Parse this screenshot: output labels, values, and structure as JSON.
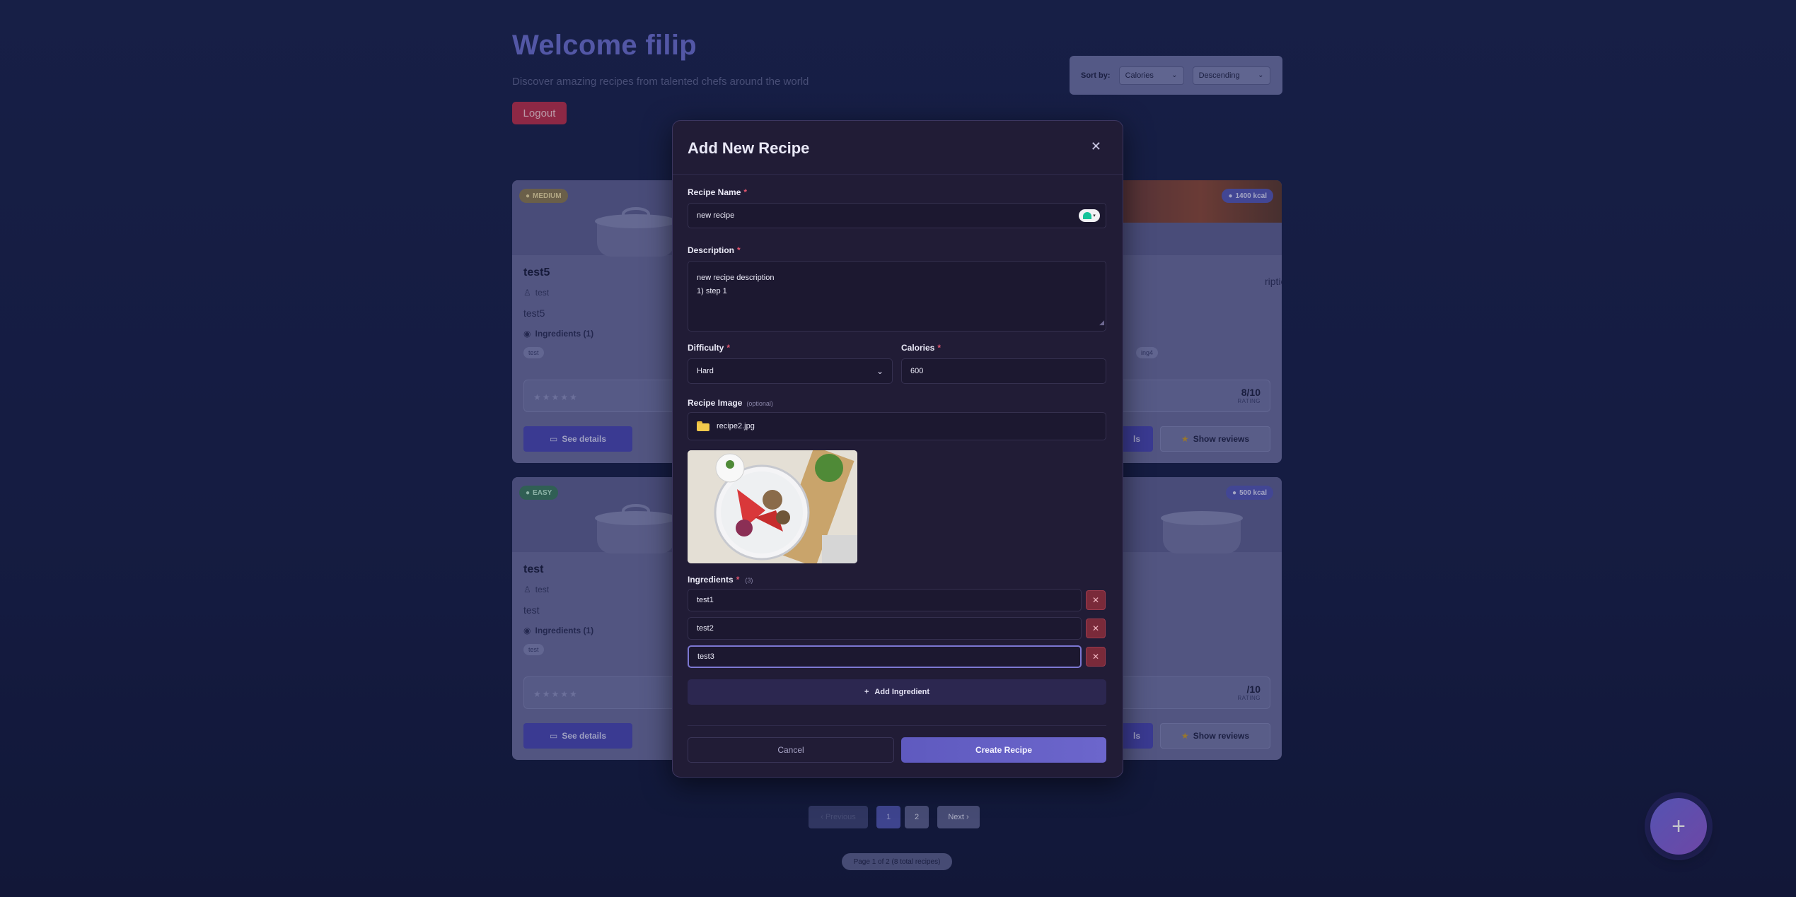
{
  "header": {
    "welcome": "Welcome filip",
    "subtitle": "Discover amazing recipes from talented chefs around the world",
    "logout_label": "Logout"
  },
  "sort": {
    "label": "Sort by:",
    "field_value": "Calories",
    "order_value": "Descending"
  },
  "cards": [
    {
      "badge": "MEDIUM",
      "name": "test5",
      "author": "test",
      "description": "test5",
      "ingredients_label": "Ingredients (1)",
      "tag": "test",
      "details_label": "See details"
    },
    {
      "kcal": "1400 kcal",
      "desc_partial": "ription",
      "tags_partial": [
        "ing4"
      ],
      "score": "8/10",
      "rating_label": "RATING",
      "details_partial": "ls",
      "reviews_label": "Show reviews"
    },
    {
      "badge": "EASY",
      "name": "test",
      "author": "test",
      "description": "test",
      "ingredients_label": "Ingredients (1)",
      "tag": "test",
      "details_label": "See details"
    },
    {
      "kcal": "500 kcal",
      "score": "/10",
      "rating_label": "RATING",
      "details_partial": "ls",
      "reviews_label": "Show reviews"
    }
  ],
  "pagination": {
    "prev_label": "‹ Previous",
    "page1": "1",
    "page2": "2",
    "next_label": "Next ›",
    "info": "Page 1 of 2 (8 total recipes)"
  },
  "fab": {
    "label": "+"
  },
  "modal": {
    "title": "Add New Recipe",
    "close_label": "✕",
    "name_label": "Recipe Name",
    "name_value": "new recipe",
    "description_label": "Description",
    "description_lines": [
      "new recipe description",
      "1) step 1"
    ],
    "difficulty_label": "Difficulty",
    "difficulty_value": "Hard",
    "calories_label": "Calories",
    "calories_value": "600",
    "image_label": "Recipe Image",
    "image_optional": "(optional)",
    "image_file": "recipe2.jpg",
    "ingredients_label": "Ingredients",
    "ingredients_count": "(3)",
    "ingredients": [
      "test1",
      "test2",
      "test3"
    ],
    "add_ingredient_label": "Add Ingredient",
    "cancel_label": "Cancel",
    "create_label": "Create Recipe",
    "required_mark": "*"
  },
  "colors": {
    "accent": "#6b6fd0",
    "modal_bg": "#211c36",
    "danger": "#b8304f",
    "primary_button": "#6c66cc"
  }
}
